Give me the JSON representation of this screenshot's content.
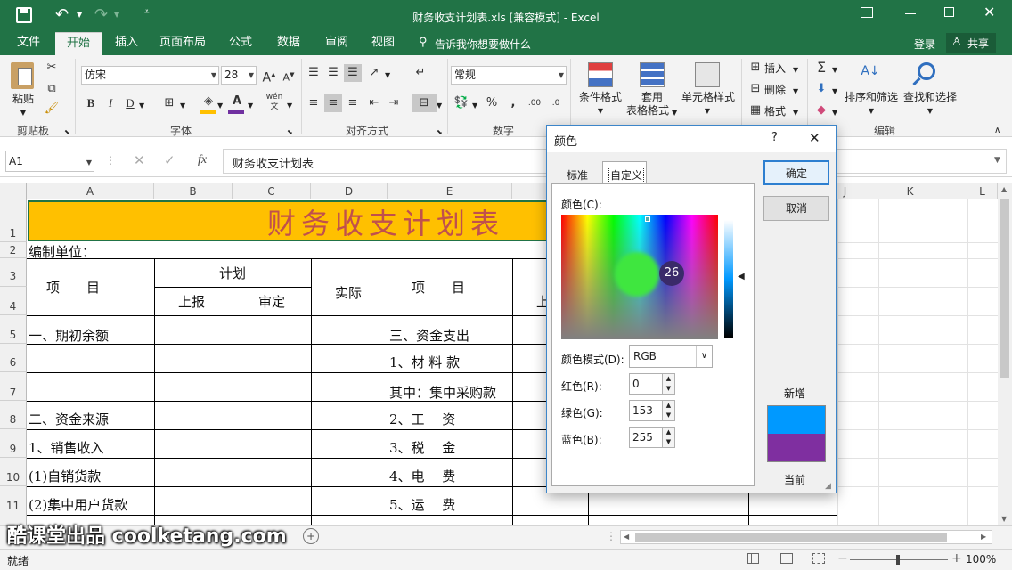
{
  "titlebar": {
    "title": "财务收支计划表.xls  [兼容模式] - Excel",
    "login": "登录",
    "share": "共享"
  },
  "tabs": [
    "文件",
    "开始",
    "插入",
    "页面布局",
    "公式",
    "数据",
    "审阅",
    "视图"
  ],
  "tellme": "告诉我你想要做什么",
  "ribbon": {
    "paste": "粘贴",
    "clipboard": "剪贴板",
    "font_name": "仿宋",
    "font_size": "28",
    "font": "字体",
    "bold": "B",
    "italic": "I",
    "underline": "D",
    "align": "对齐方式",
    "number_format": "常规",
    "number": "数字",
    "percent": "%",
    "cond_format": "条件格式",
    "table_format_1": "套用",
    "table_format_2": "表格格式",
    "cell_style": "单元格样式",
    "insert": "插入",
    "delete": "删除",
    "format": "格式",
    "cells_label": "编辑",
    "sort_filter": "排序和筛选",
    "find_select": "查找和选择",
    "wen": "wén"
  },
  "formula": {
    "namebox": "A1",
    "fx": "fx",
    "content": "财务收支计划表"
  },
  "columns": [
    "A",
    "B",
    "C",
    "D",
    "E",
    "J",
    "K",
    "L"
  ],
  "rows": [
    "1",
    "2",
    "3",
    "4",
    "5",
    "6",
    "7",
    "8",
    "9",
    "10",
    "11"
  ],
  "sheet": {
    "title": "财务收支计划表",
    "unit": "编制单位：",
    "item": "项　　目",
    "plan": "计划",
    "reported": "上报",
    "approved": "审定",
    "actual": "实际",
    "item2": "项　　目",
    "shang": "上",
    "left": [
      "一、期初余额",
      "",
      "",
      "二、资金来源",
      "1、销售收入",
      "(1)自销货款",
      "(2)集中用户货款"
    ],
    "right": [
      "三、资金支出",
      "1、材 料 款",
      "其中：集中采购款",
      "2、工　 资",
      "3、税　 金",
      "4、电　 费",
      "5、运　 费"
    ]
  },
  "dialog": {
    "title": "颜色",
    "help": "?",
    "close": "✕",
    "tab_standard": "标准",
    "tab_custom": "自定义",
    "colors_label": "颜色(C):",
    "mode_label": "颜色模式(D):",
    "mode_value": "RGB",
    "red_label": "红色(R):",
    "green_label": "绿色(G):",
    "blue_label": "蓝色(B):",
    "red": "0",
    "green": "153",
    "blue": "255",
    "ok": "确定",
    "cancel": "取消",
    "new": "新增",
    "current": "当前",
    "new_color": "#0099ff",
    "current_color": "#7f2fa0",
    "badge": "26"
  },
  "status": {
    "ready": "就绪",
    "zoom": "100%"
  },
  "watermark": "酷课堂出品 coolketang.com",
  "colors": {
    "brand": "#217346",
    "title_fill": "#ffc000",
    "title_text": "#c0504d"
  }
}
